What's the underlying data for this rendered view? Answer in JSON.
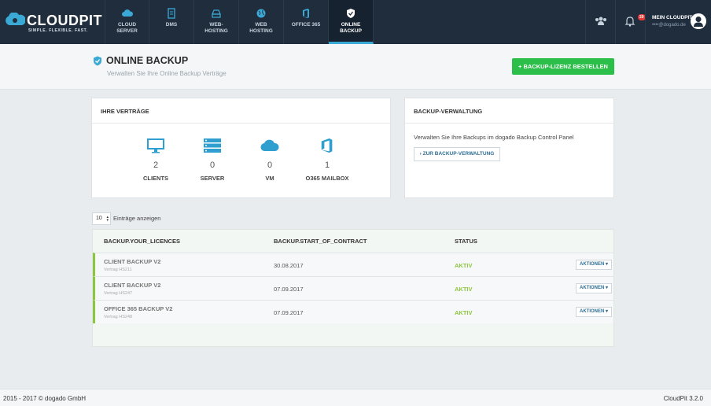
{
  "brand": {
    "name": "CLOUDPIT",
    "tagline": "SIMPLE. FLEXIBLE. FAST."
  },
  "nav": [
    {
      "l1": "CLOUD",
      "l2": "SERVER",
      "icon": "cloud-icon"
    },
    {
      "l1": "DMS",
      "l2": "",
      "icon": "document-icon"
    },
    {
      "l1": "WEB-",
      "l2": "HOSTING",
      "icon": "hdd-icon"
    },
    {
      "l1": "WEB",
      "l2": "HOSTING",
      "icon": "globe-icon"
    },
    {
      "l1": "OFFICE 365",
      "l2": "",
      "icon": "office-icon"
    },
    {
      "l1": "ONLINE",
      "l2": "BACKUP",
      "icon": "shield-icon",
      "active": true
    }
  ],
  "topbar": {
    "notification_count": "20",
    "user_title": "MEIN CLOUDPIT",
    "user_email": "••••@dogado.de"
  },
  "page": {
    "title": "ONLINE BACKUP",
    "subtitle": "Verwalten Sie Ihre Online Backup Verträge",
    "order_button": "+ BACKUP-LIZENZ BESTELLEN"
  },
  "contracts": {
    "title": "IHRE VERTRÄGE",
    "stats": [
      {
        "value": "2",
        "label": "CLIENTS",
        "icon": "monitor-icon"
      },
      {
        "value": "0",
        "label": "SERVER",
        "icon": "server-icon"
      },
      {
        "value": "0",
        "label": "VM",
        "icon": "cloud-icon"
      },
      {
        "value": "1",
        "label": "O365 MAILBOX",
        "icon": "office-icon"
      }
    ]
  },
  "backup_mgmt": {
    "title": "BACKUP-VERWALTUNG",
    "text": "Verwalten Sie Ihre Backups im dogado Backup Control Panel",
    "button": "› ZUR BACKUP-VERWALTUNG"
  },
  "entries": {
    "value": "10",
    "label": "Einträge anzeigen"
  },
  "table": {
    "headers": [
      "BACKUP.YOUR_LICENCES",
      "BACKUP.START_OF_CONTRACT",
      "STATUS"
    ],
    "rows": [
      {
        "name": "CLIENT BACKUP V2",
        "contract": "Vertrag HS211",
        "date": "30.08.2017",
        "status": "AKTIV",
        "action": "AKTIONEN ▾"
      },
      {
        "name": "CLIENT BACKUP V2",
        "contract": "Vertrag HS247",
        "date": "07.09.2017",
        "status": "AKTIV",
        "action": "AKTIONEN ▾"
      },
      {
        "name": "OFFICE 365 BACKUP V2",
        "contract": "Vertrag HS248",
        "date": "07.09.2017",
        "status": "AKTIV",
        "action": "AKTIONEN ▾"
      }
    ]
  },
  "footer": {
    "copyright": "2015 - 2017 © dogado GmbH",
    "version": "CloudPit 3.2.0"
  },
  "colors": {
    "accent": "#3aa9d6",
    "green": "#2bbf4a",
    "status_green": "#8cc63f",
    "nav_bg": "#1f2d3d"
  }
}
